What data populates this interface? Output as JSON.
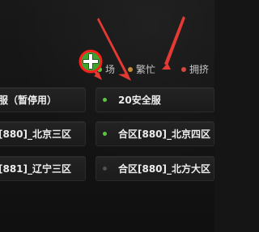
{
  "colors": {
    "smooth": "#58c83f",
    "busy": "#c58d36",
    "crowded": "#d44841",
    "maintenance": "#505050",
    "annotation_red": "#e33a33"
  },
  "legend": [
    {
      "id": "smooth",
      "label": "场"
    },
    {
      "id": "busy",
      "label": "繁忙"
    },
    {
      "id": "crowded",
      "label": "拥挤"
    }
  ],
  "servers": [
    {
      "column": "left",
      "row": 1,
      "label": "服（暂停用）"
    },
    {
      "column": "left",
      "row": 2,
      "label": "[880]_北京三区"
    },
    {
      "column": "left",
      "row": 3,
      "label": "[881]_辽宁三区"
    },
    {
      "column": "right",
      "row": 1,
      "status": "smooth",
      "label": "20安全服"
    },
    {
      "column": "right",
      "row": 2,
      "status": "smooth",
      "label": "合区[880]_北京四区"
    },
    {
      "column": "right",
      "row": 3,
      "status": "maintenance",
      "label": "合区[880]_北方大区"
    }
  ],
  "annotation": {
    "cursor": "crosshair-cursor-icon",
    "arrows": 3
  }
}
